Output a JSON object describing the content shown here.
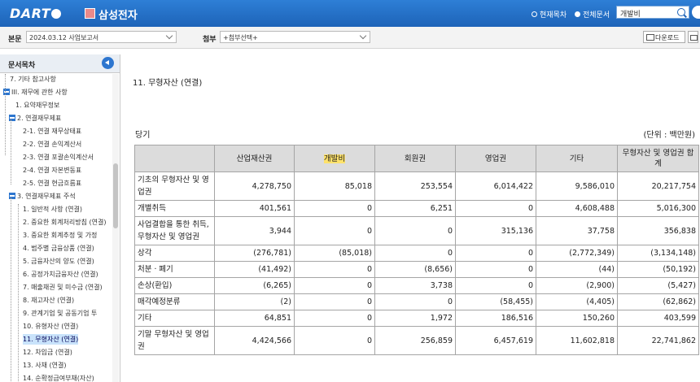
{
  "app": {
    "logo": "DART",
    "company": "삼성전자"
  },
  "search": {
    "scope_current": "현재목차",
    "scope_all": "전체문서",
    "value": "개발비",
    "selected_scope": "전체문서"
  },
  "filters": {
    "main_label": "본문",
    "main_value": "2024.03.12  사업보고서",
    "attach_label": "첨부",
    "attach_value": "+첨부선택+",
    "download_label": "다운로드"
  },
  "sidebar": {
    "title": "문서목차",
    "items": [
      {
        "label": "7. 기타 참고사항",
        "expanded": false,
        "selected": false
      },
      {
        "label": "III. 재무에 관한 사항",
        "expanded": true,
        "selected": false
      },
      {
        "label": "1. 요약재무정보",
        "expanded": false,
        "selected": false
      },
      {
        "label": "2. 연결재무제표",
        "expanded": true,
        "selected": false
      },
      {
        "label": "2-1. 연결 재무상태표",
        "expanded": false,
        "selected": false
      },
      {
        "label": "2-2. 연결 손익계산서",
        "expanded": false,
        "selected": false
      },
      {
        "label": "2-3. 연결 포괄손익계산서",
        "expanded": false,
        "selected": false
      },
      {
        "label": "2-4. 연결 자본변동표",
        "expanded": false,
        "selected": false
      },
      {
        "label": "2-5. 연결 현금흐름표",
        "expanded": false,
        "selected": false
      },
      {
        "label": "3. 연결재무제표 주석",
        "expanded": true,
        "selected": false
      },
      {
        "label": "1. 일반적 사항 (연결)",
        "expanded": false,
        "selected": false
      },
      {
        "label": "2. 중요한 회계처리방침 (연결)",
        "expanded": false,
        "selected": false
      },
      {
        "label": "3. 중요한 회계추정 및 가정",
        "expanded": false,
        "selected": false
      },
      {
        "label": "4. 범주별 금융상품 (연결)",
        "expanded": false,
        "selected": false
      },
      {
        "label": "5. 금융자산의 양도 (연결)",
        "expanded": false,
        "selected": false
      },
      {
        "label": "6. 공정가치금융자산 (연결)",
        "expanded": false,
        "selected": false
      },
      {
        "label": "7. 매출채권 및 미수금 (연결)",
        "expanded": false,
        "selected": false
      },
      {
        "label": "8. 재고자산 (연결)",
        "expanded": false,
        "selected": false
      },
      {
        "label": "9. 관계기업 및 공동기업 투",
        "expanded": false,
        "selected": false
      },
      {
        "label": "10. 유형자산 (연결)",
        "expanded": false,
        "selected": false
      },
      {
        "label": "11. 무형자산 (연결)",
        "expanded": false,
        "selected": true
      },
      {
        "label": "12. 차입금 (연결)",
        "expanded": false,
        "selected": false
      },
      {
        "label": "13. 사채 (연결)",
        "expanded": false,
        "selected": false
      },
      {
        "label": "14. 순확정급여부채(자산)",
        "expanded": false,
        "selected": false
      }
    ]
  },
  "content": {
    "section_title": "11. 무형자산 (연결)",
    "period": "당기",
    "unit": "(단위 : 백만원)",
    "columns": [
      "",
      "산업재산권",
      "개발비",
      "회원권",
      "영업권",
      "기타",
      "무형자산 및 영업권 합계"
    ],
    "highlight": "개발비",
    "rows": [
      [
        "기초의 무형자산 및 영업권",
        "4,278,750",
        "85,018",
        "253,554",
        "6,014,422",
        "9,586,010",
        "20,217,754"
      ],
      [
        "개별취득",
        "401,561",
        "0",
        "6,251",
        "0",
        "4,608,488",
        "5,016,300"
      ],
      [
        "사업결합을 통한 취득, 무형자산 및 영업권",
        "3,944",
        "0",
        "0",
        "315,136",
        "37,758",
        "356,838"
      ],
      [
        "상각",
        "(276,781)",
        "(85,018)",
        "0",
        "0",
        "(2,772,349)",
        "(3,134,148)"
      ],
      [
        "처분ㆍ폐기",
        "(41,492)",
        "0",
        "(8,656)",
        "0",
        "(44)",
        "(50,192)"
      ],
      [
        "손상(환입)",
        "(6,265)",
        "0",
        "3,738",
        "0",
        "(2,900)",
        "(5,427)"
      ],
      [
        "매각예정분류",
        "(2)",
        "0",
        "0",
        "(58,455)",
        "(4,405)",
        "(62,862)"
      ],
      [
        "기타",
        "64,851",
        "0",
        "1,972",
        "186,516",
        "150,260",
        "403,599"
      ],
      [
        "기말 무형자산 및 영업권",
        "4,424,566",
        "0",
        "256,859",
        "6,457,619",
        "11,602,818",
        "22,741,862"
      ]
    ]
  }
}
